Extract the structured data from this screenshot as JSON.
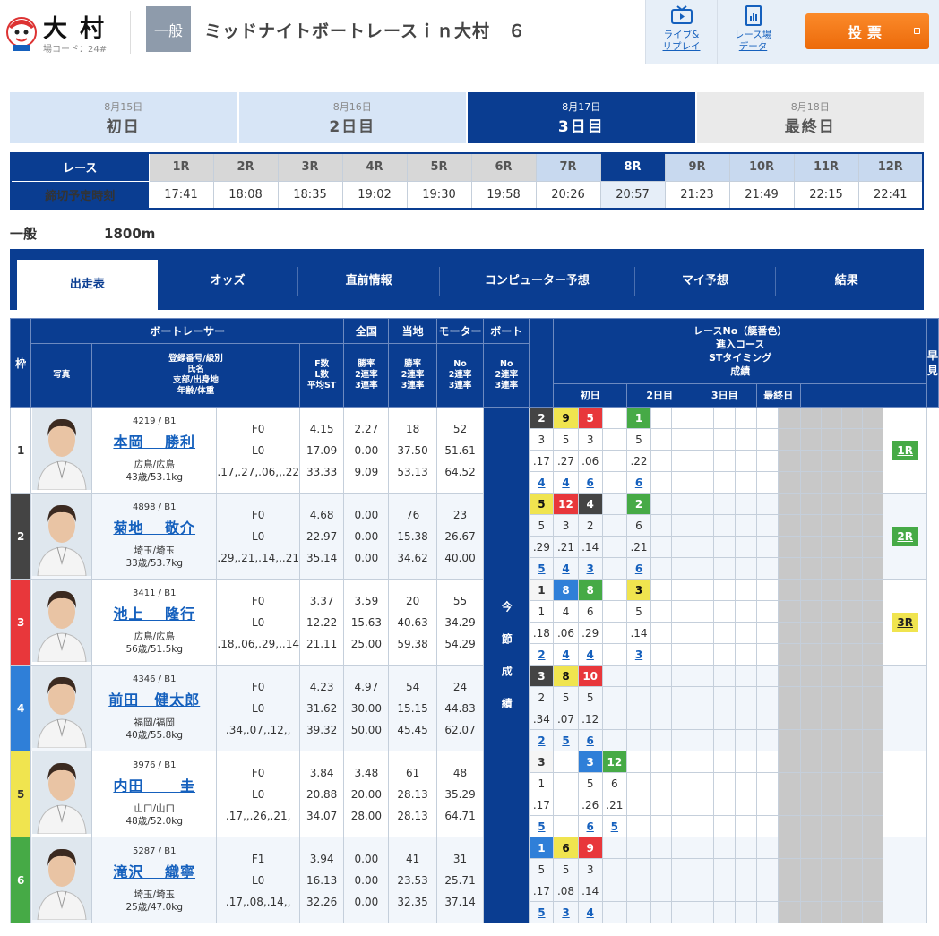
{
  "header": {
    "venue": "大村",
    "venue_code": "場コード：24#",
    "grade": "一般",
    "race_title": "ミッドナイトボートレースｉｎ大村　６",
    "live_label": [
      "ライブ&",
      "リプレイ"
    ],
    "data_label": [
      "レース場",
      "データ"
    ],
    "vote_label": "投票"
  },
  "days": [
    {
      "date": "8月15日",
      "name": "初日",
      "state": "past"
    },
    {
      "date": "8月16日",
      "name": "2日目",
      "state": "past"
    },
    {
      "date": "8月17日",
      "name": "3日目",
      "state": "active"
    },
    {
      "date": "8月18日",
      "name": "最終日",
      "state": "future"
    }
  ],
  "race_nav": {
    "race_label": "レース",
    "deadline_label": "締切予定時刻",
    "races": [
      "1R",
      "2R",
      "3R",
      "4R",
      "5R",
      "6R",
      "7R",
      "8R",
      "9R",
      "10R",
      "11R",
      "12R"
    ],
    "times": [
      "17:41",
      "18:08",
      "18:35",
      "19:02",
      "19:30",
      "19:58",
      "20:26",
      "20:57",
      "21:23",
      "21:49",
      "22:15",
      "22:41"
    ],
    "current": "8R"
  },
  "race_info": {
    "class": "一般",
    "distance": "1800m"
  },
  "tabs": [
    "出走表",
    "オッズ",
    "直前情報",
    "コンピューター予想",
    "マイ予想",
    "結果"
  ],
  "table_headers": {
    "frame": "枠",
    "photo": "写真",
    "racer": "ボートレーサー",
    "racer_sub": [
      "登録番号/級別",
      "氏名",
      "支部/出身地",
      "年齢/体重"
    ],
    "f_sub": [
      "F数",
      "L数",
      "平均ST"
    ],
    "national": "全国",
    "local": "当地",
    "motor": "モーター",
    "boat": "ボート",
    "rate_sub": [
      "勝率",
      "2連率",
      "3連率"
    ],
    "no_sub": [
      "No",
      "2連率",
      "3連率"
    ],
    "results_title": [
      "レースNo（艇番色）",
      "進入コース",
      "STタイミング",
      "成績"
    ],
    "days": [
      "初日",
      "2日目",
      "3日目",
      "最終日"
    ],
    "session": "今節成績",
    "early": "早見"
  },
  "racers": [
    {
      "frame": "1",
      "reg": "4219 / B1",
      "name": "本岡　 勝利",
      "branch": "広島/広島",
      "age": "43歳/53.1kg",
      "f": "F0",
      "l": "L0",
      "st": [
        ".17",
        ".27",
        ".06",
        "",
        ".22"
      ],
      "nat": [
        "4.15",
        "17.09",
        "33.33"
      ],
      "loc": [
        "2.27",
        "0.00",
        "9.09"
      ],
      "motor": [
        "18",
        "37.50",
        "53.13"
      ],
      "boat": [
        "52",
        "51.61",
        "64.52"
      ],
      "races": [
        {
          "no": "2",
          "c": 2
        },
        {
          "no": "9",
          "c": 5
        },
        {
          "no": "5",
          "c": 3
        },
        {
          "no": "",
          "c": 0
        },
        {
          "no": "1",
          "c": 6
        }
      ],
      "course": [
        "3",
        "5",
        "3",
        "",
        "5"
      ],
      "rank": [
        "4",
        "4",
        "6",
        "",
        "6"
      ],
      "early": "1R"
    },
    {
      "frame": "2",
      "reg": "4898 / B1",
      "name": "菊地　 敬介",
      "branch": "埼玉/埼玉",
      "age": "33歳/53.7kg",
      "f": "F0",
      "l": "L0",
      "st": [
        ".29",
        ".21",
        ".14",
        "",
        ".21"
      ],
      "nat": [
        "4.68",
        "22.97",
        "35.14"
      ],
      "loc": [
        "0.00",
        "0.00",
        "0.00"
      ],
      "motor": [
        "76",
        "15.38",
        "34.62"
      ],
      "boat": [
        "23",
        "26.67",
        "40.00"
      ],
      "races": [
        {
          "no": "5",
          "c": 5
        },
        {
          "no": "12",
          "c": 3
        },
        {
          "no": "4",
          "c": 2
        },
        {
          "no": "",
          "c": 0
        },
        {
          "no": "2",
          "c": 6
        }
      ],
      "course": [
        "5",
        "3",
        "2",
        "",
        "6"
      ],
      "rank": [
        "5",
        "4",
        "3",
        "",
        "6"
      ],
      "early": "2R"
    },
    {
      "frame": "3",
      "reg": "3411 / B1",
      "name": "池上　 隆行",
      "branch": "広島/広島",
      "age": "56歳/51.5kg",
      "f": "F0",
      "l": "L0",
      "st": [
        ".18",
        ".06",
        ".29",
        "",
        ".14"
      ],
      "nat": [
        "3.37",
        "12.22",
        "21.11"
      ],
      "loc": [
        "3.59",
        "15.63",
        "25.00"
      ],
      "motor": [
        "20",
        "40.63",
        "59.38"
      ],
      "boat": [
        "55",
        "34.29",
        "54.29"
      ],
      "races": [
        {
          "no": "1",
          "c": 1
        },
        {
          "no": "8",
          "c": 4
        },
        {
          "no": "8",
          "c": 6
        },
        {
          "no": "",
          "c": 0
        },
        {
          "no": "3",
          "c": 5
        }
      ],
      "course": [
        "1",
        "4",
        "6",
        "",
        "5"
      ],
      "rank": [
        "2",
        "4",
        "4",
        "",
        "3"
      ],
      "early": "3R"
    },
    {
      "frame": "4",
      "reg": "4346 / B1",
      "name": "前田　健太郎",
      "branch": "福岡/福岡",
      "age": "40歳/55.8kg",
      "f": "F0",
      "l": "L0",
      "st": [
        ".34",
        ".07",
        ".12",
        "",
        ""
      ],
      "nat": [
        "4.23",
        "31.62",
        "39.32"
      ],
      "loc": [
        "4.97",
        "30.00",
        "50.00"
      ],
      "motor": [
        "54",
        "15.15",
        "45.45"
      ],
      "boat": [
        "24",
        "44.83",
        "62.07"
      ],
      "races": [
        {
          "no": "3",
          "c": 2
        },
        {
          "no": "8",
          "c": 5
        },
        {
          "no": "10",
          "c": 3
        },
        {
          "no": "",
          "c": 0
        },
        {
          "no": "",
          "c": 0
        }
      ],
      "course": [
        "2",
        "5",
        "5",
        "",
        ""
      ],
      "rank": [
        "2",
        "5",
        "6",
        "",
        ""
      ],
      "early": ""
    },
    {
      "frame": "5",
      "reg": "3976 / B1",
      "name": "内田　　 圭",
      "branch": "山口/山口",
      "age": "48歳/52.0kg",
      "f": "F0",
      "l": "L0",
      "st": [
        ".17",
        "",
        ".26",
        ".21",
        ""
      ],
      "nat": [
        "3.84",
        "20.88",
        "34.07"
      ],
      "loc": [
        "3.48",
        "20.00",
        "28.00"
      ],
      "motor": [
        "61",
        "28.13",
        "28.13"
      ],
      "boat": [
        "48",
        "35.29",
        "64.71"
      ],
      "races": [
        {
          "no": "3",
          "c": 1
        },
        {
          "no": "",
          "c": 0
        },
        {
          "no": "3",
          "c": 4
        },
        {
          "no": "12",
          "c": 6
        },
        {
          "no": "",
          "c": 0
        }
      ],
      "course": [
        "1",
        "",
        "5",
        "6",
        ""
      ],
      "rank": [
        "5",
        "",
        "6",
        "5",
        ""
      ],
      "early": ""
    },
    {
      "frame": "6",
      "reg": "5287 / B1",
      "name": "滝沢　 織寧",
      "branch": "埼玉/埼玉",
      "age": "25歳/47.0kg",
      "f": "F1",
      "l": "L0",
      "st": [
        ".17",
        ".08",
        ".14",
        "",
        ""
      ],
      "nat": [
        "3.94",
        "16.13",
        "32.26"
      ],
      "loc": [
        "0.00",
        "0.00",
        "0.00"
      ],
      "motor": [
        "41",
        "23.53",
        "32.35"
      ],
      "boat": [
        "31",
        "25.71",
        "37.14"
      ],
      "races": [
        {
          "no": "1",
          "c": 4
        },
        {
          "no": "6",
          "c": 5
        },
        {
          "no": "9",
          "c": 3
        },
        {
          "no": "",
          "c": 0
        },
        {
          "no": "",
          "c": 0
        }
      ],
      "course": [
        "5",
        "5",
        "3",
        "",
        ""
      ],
      "rank": [
        "5",
        "3",
        "4",
        "",
        ""
      ],
      "early": ""
    }
  ],
  "colors": {
    "navy": "#0a3d91",
    "frame": [
      "#ffffff",
      "#444444",
      "#e8373b",
      "#2f7fd8",
      "#f0e44f",
      "#46aa46"
    ],
    "early": [
      "#46aa46",
      "#46aa46",
      "#f0e44f"
    ]
  }
}
